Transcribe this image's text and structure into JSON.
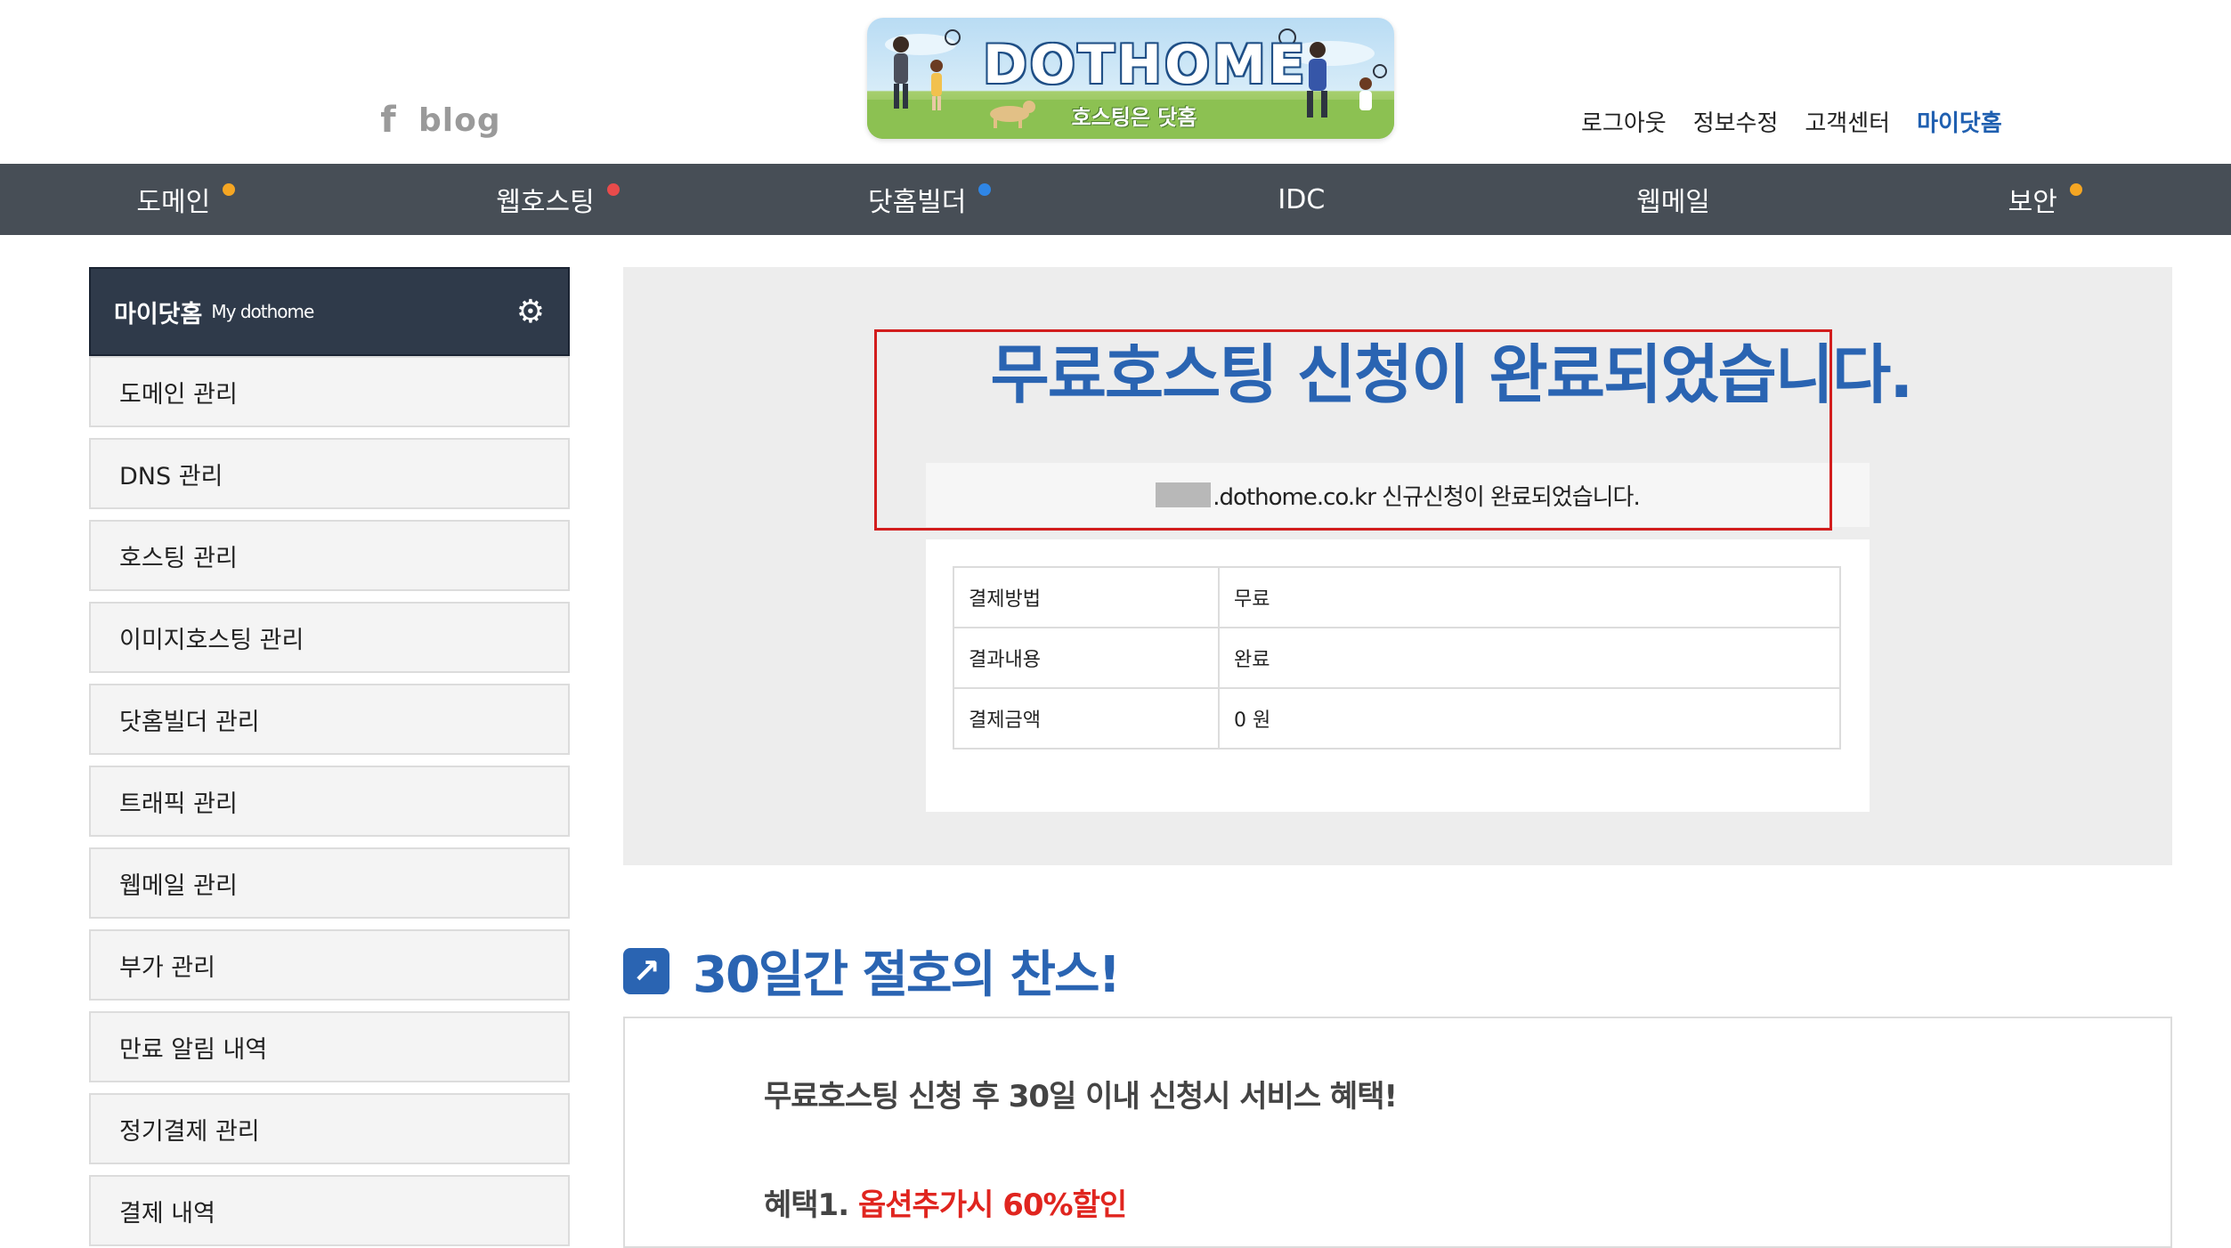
{
  "header": {
    "social": {
      "facebook_icon": "f",
      "blog_label": "blog"
    },
    "logo": {
      "title": "DOTHOME",
      "subtitle": "호스팅은 닷홈"
    },
    "topnav": [
      "로그아웃",
      "정보수정",
      "고객센터",
      "마이닷홈"
    ]
  },
  "mainnav": [
    {
      "label": "도메인",
      "dot_color": "#f5a623"
    },
    {
      "label": "웹호스팅",
      "dot_color": "#e94b4b"
    },
    {
      "label": "닷홈빌더",
      "dot_color": "#2f86e6"
    },
    {
      "label": "IDC",
      "dot_color": ""
    },
    {
      "label": "웹메일",
      "dot_color": ""
    },
    {
      "label": "보안",
      "dot_color": "#f5a623"
    }
  ],
  "sidebar": {
    "title": "마이닷홈",
    "title_en": "My dothome",
    "items": [
      "도메인 관리",
      "DNS 관리",
      "호스팅 관리",
      "이미지호스팅 관리",
      "닷홈빌더 관리",
      "트래픽 관리",
      "웹메일 관리",
      "부가 관리",
      "만료 알림 내역",
      "정기결제 관리",
      "결제 내역"
    ]
  },
  "result": {
    "title": "무료호스팅 신청이 완료되었습니다.",
    "message": ".dothome.co.kr 신규신청이 완료되었습니다.",
    "table": [
      {
        "label": "결제방법",
        "value": "무료"
      },
      {
        "label": "결과내용",
        "value": "완료"
      },
      {
        "label": "결제금액",
        "value": "0 원"
      }
    ]
  },
  "promo": {
    "title": "30일간 절호의 찬스!",
    "lead": "무료호스팅 신청 후 30일 이내 신청시 서비스 혜택!",
    "benefit1_prefix": "혜택1. ",
    "benefit1_highlight": "옵션추가시 60%할인"
  },
  "colors": {
    "accent": "#2a64b2",
    "nav_bg": "#474e56",
    "sidebar_head": "#2f3a4a",
    "highlight_border": "#d21d1d",
    "promo_red": "#e0251f"
  }
}
